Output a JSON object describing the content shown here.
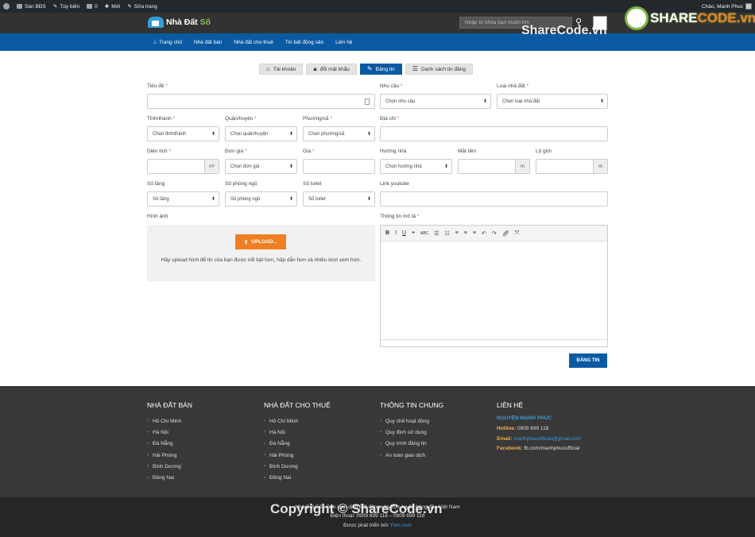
{
  "adminbar": {
    "site": "Sàn BĐS",
    "customize": "Tùy biến",
    "comments": "0",
    "new": "Mới",
    "edit": "Sửa trang",
    "greeting": "Chào, Manh Phuc"
  },
  "header": {
    "logo_main": "Nhà Đất ",
    "logo_accent": "Số",
    "search_placeholder": "Nhập từ khóa bạn muốn tìm"
  },
  "nav": [
    "Trang chủ",
    "Nhà đất bán",
    "Nhà đất cho thuê",
    "Tin bất động sản",
    "Liên hệ"
  ],
  "tabs": [
    {
      "label": "Tài khoản",
      "icon": "home-icon"
    },
    {
      "label": "đổi mật khẩu",
      "icon": "lock-icon"
    },
    {
      "label": "Đăng tin",
      "icon": "edit-icon",
      "active": true
    },
    {
      "label": "Danh sách tin đăng",
      "icon": "list-icon"
    }
  ],
  "form": {
    "title_label": "Tiêu đề",
    "need_label": "Nhu cầu",
    "need_value": "Chọn nhu cầu",
    "type_label": "Loại nhà đất",
    "type_value": "Chọn loại nhà đất",
    "province_label": "Tỉnh/thành",
    "province_value": "Chọn tỉnh/thành",
    "district_label": "Quận/huyện",
    "district_value": "Chọn quận/huyện",
    "ward_label": "Phường/xã",
    "ward_value": "Chọn phường/xã",
    "address_label": "Địa chỉ",
    "area_label": "Diện tích",
    "area_unit": "m²",
    "price_unit_label": "Đơn giá",
    "price_unit_value": "Chọn đơn giá",
    "price_label": "Giá",
    "direction_label": "Hướng nhà",
    "direction_value": "Chọn hướng nhà",
    "frontage_label": "Mặt tiền",
    "frontage_unit": "m",
    "road_label": "Lộ giới",
    "road_unit": "m",
    "floors_label": "Số tầng",
    "floors_value": "Số tầng",
    "bedrooms_label": "Số phòng ngủ",
    "bedrooms_value": "Số phòng ngủ",
    "toilets_label": "Số toilet",
    "toilets_value": "Số toilet",
    "youtube_label": "Link youtube",
    "images_label": "Hình ảnh",
    "upload_button": "UPLOAD...",
    "upload_note": "Hãy upload hình để tin của bạn được nổi bật hơn, hấp dẫn hơn và nhiều lượt xem hơn.",
    "desc_label": "Thông tin mô tả",
    "submit_button": "ĐĂNG TIN"
  },
  "footer": {
    "col1": {
      "title": "NHÀ ĐẤT BÁN",
      "items": [
        "Hồ Chí Minh",
        "Hà Nội",
        "Đà Nẵng",
        "Hải Phòng",
        "Bình Dương",
        "Đồng Nai"
      ]
    },
    "col2": {
      "title": "NHÀ ĐẤT CHO THUÊ",
      "items": [
        "Hồ Chí Minh",
        "Hà Nội",
        "Đà Nẵng",
        "Hải Phòng",
        "Bình Dương",
        "Đồng Nai"
      ]
    },
    "col3": {
      "title": "THÔNG TIN CHUNG",
      "items": [
        "Quy chế hoạt động",
        "Quy định sử dụng",
        "Quy trình đăng tin",
        "An toàn giao dịch"
      ]
    },
    "col4": {
      "title": "LIÊN HỆ",
      "name": "NGUYỄN MẠNH PHÚC",
      "hotline_label": "Hotline:",
      "hotline": "0909 699 118",
      "email_label": "Email:",
      "email": "manhphucofficial@gmail.com",
      "facebook_label": "Facebook:",
      "facebook": "fb.com/manhphucofficial"
    }
  },
  "copyright": {
    "line1": "Nhà Đất Số - Sàn giao dịch Bất động sản trực tuyến hàng đầu Việt Nam",
    "line2": "Điện thoại: 0909 699 118 – 0909 699 118",
    "line3_prefix": "Được phát triển bởi ",
    "line3_link": "Yivic.com"
  },
  "watermark": {
    "top_text": "ShareCode.vn",
    "logo_text_a": "SHARE",
    "logo_text_b": "CODE.vn",
    "bottom_text": "Copyright © ShareCode.vn"
  }
}
